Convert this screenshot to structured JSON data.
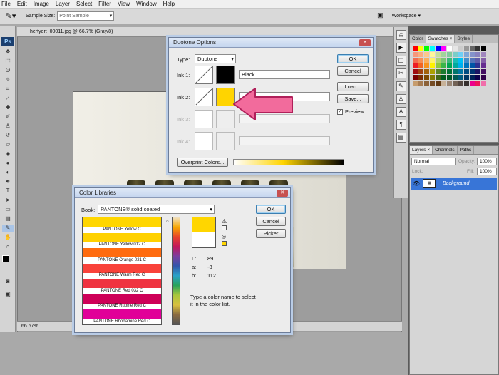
{
  "menubar": {
    "items": [
      "File",
      "Edit",
      "Image",
      "Layer",
      "Select",
      "Filter",
      "View",
      "Window",
      "Help"
    ]
  },
  "options_bar": {
    "sample_size_label": "Sample Size:",
    "sample_size_value": "Point Sample",
    "workspace_label": "Workspace ▾"
  },
  "document": {
    "tab_title": "hertyert_00011.jpg @ 66.7% (Gray/8)",
    "zoom": "66.67%"
  },
  "panels": {
    "swatches_tabs": [
      "Color",
      "Swatches ×",
      "Styles"
    ],
    "layers_tabs": [
      "Layers ×",
      "Channels",
      "Paths"
    ],
    "blend_mode": "Normal",
    "opacity_label": "Opacity:",
    "opacity_value": "100%",
    "lock_label": "Lock:",
    "fill_label": "Fill:",
    "fill_value": "100%",
    "layer_name": "Background"
  },
  "duotone": {
    "title": "Duotone Options",
    "type_label": "Type:",
    "type_value": "Duotone",
    "ink1_label": "Ink 1:",
    "ink1_name": "Black",
    "ink1_color": "#000000",
    "ink2_label": "Ink 2:",
    "ink2_color": "#ffd400",
    "ink3_label": "Ink 3:",
    "ink4_label": "Ink 4:",
    "overprint_button": "Overprint Colors...",
    "ok": "OK",
    "cancel": "Cancel",
    "load": "Load...",
    "save": "Save...",
    "preview_label": "Preview",
    "preview_checked": true
  },
  "color_libraries": {
    "title": "Color Libraries",
    "book_label": "Book:",
    "book_value": "PANTONE® solid coated",
    "items": [
      {
        "name": "PANTONE Yellow C",
        "color": "#ffd600"
      },
      {
        "name": "PANTONE Yellow 012 C",
        "color": "#ffd100"
      },
      {
        "name": "PANTONE Orange 021 C",
        "color": "#ff6b0f"
      },
      {
        "name": "PANTONE Warm Red C",
        "color": "#f9423a"
      },
      {
        "name": "PANTONE Red 032 C",
        "color": "#ef3340"
      },
      {
        "name": "PANTONE Rubine Red C",
        "color": "#ce0058"
      },
      {
        "name": "PANTONE Rhodamine Red C",
        "color": "#e10098"
      }
    ],
    "selected_color": "#ffd600",
    "L_label": "L:",
    "L": "89",
    "a_label": "a:",
    "a": "-3",
    "b_label": "b:",
    "b": "112",
    "hint": "Type a color name to select it in the color list.",
    "ok": "OK",
    "cancel": "Cancel",
    "picker": "Picker"
  },
  "annotation_colors": {
    "arrow_fill": "#f26b9c",
    "arrow_stroke": "#b0205a"
  }
}
